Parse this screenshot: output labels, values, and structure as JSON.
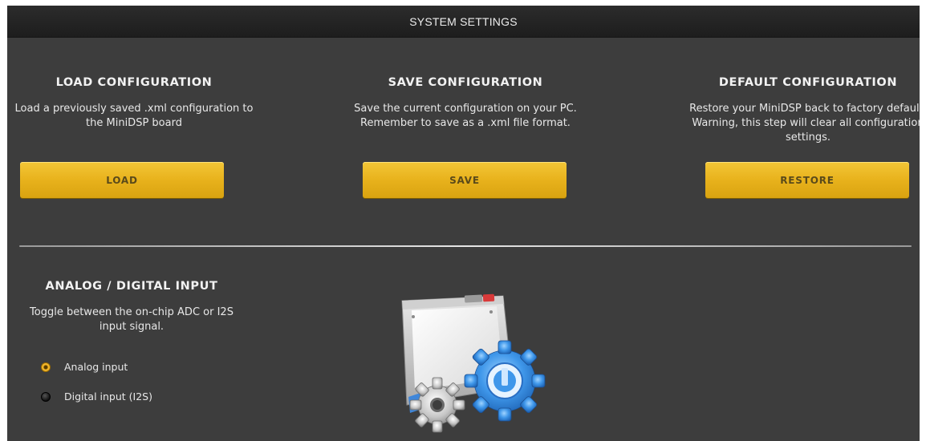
{
  "window": {
    "title": "SYSTEM SETTINGS"
  },
  "load": {
    "heading": "LOAD CONFIGURATION",
    "description": "Load a previously saved .xml configuration to the MiniDSP board",
    "button_label": "LOAD"
  },
  "save": {
    "heading": "SAVE CONFIGURATION",
    "description": "Save the current configuration on your PC. Remember to save as a .xml file format.",
    "button_label": "SAVE"
  },
  "default": {
    "heading": "DEFAULT CONFIGURATION",
    "description": "Restore your MiniDSP back to factory default. Warning, this step will clear all configuration settings.",
    "button_label": "RESTORE"
  },
  "input": {
    "heading": "ANALOG / DIGITAL INPUT",
    "description": "Toggle between the on-chip ADC or I2S input signal.",
    "options": [
      {
        "label": "Analog input",
        "selected": true
      },
      {
        "label": "Digital input (I2S)",
        "selected": false
      }
    ]
  },
  "illustration": {
    "icon": "settings-window-gears-icon"
  },
  "colors": {
    "background": "#3d3d3d",
    "titlebar": "#1d1d1d",
    "button": "#e8b21c",
    "gear_large": "#2f8be0",
    "gear_small": "#c8c8c8"
  }
}
